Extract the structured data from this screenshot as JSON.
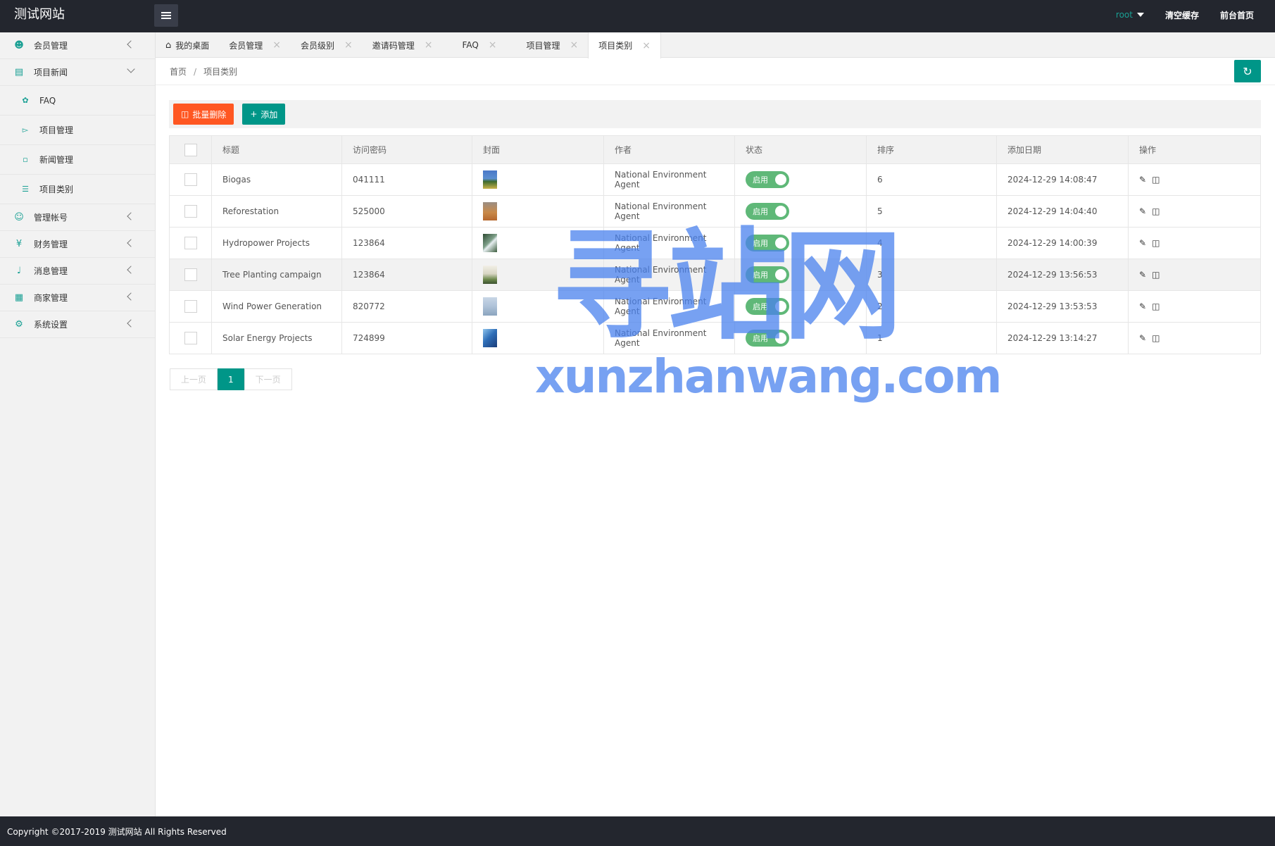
{
  "header": {
    "logo": "测试网站",
    "user": "root",
    "clear_cache": "清空缓存",
    "front_home": "前台首页"
  },
  "sidebar": {
    "items": [
      {
        "label": "会员管理",
        "icon": "user-icon"
      },
      {
        "label": "项目新闻",
        "icon": "book-icon"
      },
      {
        "label": "管理帐号",
        "icon": "users-icon"
      },
      {
        "label": "财务管理",
        "icon": "yen-icon"
      },
      {
        "label": "消息管理",
        "icon": "speaker-icon"
      },
      {
        "label": "商家管理",
        "icon": "picture-icon"
      },
      {
        "label": "系统设置",
        "icon": "gear-icon"
      }
    ],
    "sub_items": [
      {
        "label": "FAQ",
        "icon": "leaf-icon"
      },
      {
        "label": "项目管理",
        "icon": "cart-icon"
      },
      {
        "label": "新闻管理",
        "icon": "file-icon"
      },
      {
        "label": "项目类别",
        "icon": "list-icon"
      }
    ]
  },
  "tabs": [
    {
      "label": "我的桌面"
    },
    {
      "label": "会员管理"
    },
    {
      "label": "会员级别"
    },
    {
      "label": "邀请码管理"
    },
    {
      "label": "FAQ"
    },
    {
      "label": "项目管理"
    },
    {
      "label": "项目类别"
    }
  ],
  "breadcrumb": {
    "home": "首页",
    "separator": "/",
    "current": "项目类别"
  },
  "toolbar": {
    "batch_delete": "批量删除",
    "add": "添加"
  },
  "table": {
    "headers": [
      "标题",
      "访问密码",
      "封面",
      "作者",
      "状态",
      "排序",
      "添加日期",
      "操作"
    ],
    "rows": [
      {
        "title": "Biogas",
        "password": "041111",
        "author": "National Environment Agent",
        "status": "启用",
        "sort": "6",
        "date": "2024-12-29 14:08:47"
      },
      {
        "title": "Reforestation",
        "password": "525000",
        "author": "National Environment Agent",
        "status": "启用",
        "sort": "5",
        "date": "2024-12-29 14:04:40"
      },
      {
        "title": "Hydropower Projects",
        "password": "123864",
        "author": "National Environment Agent",
        "status": "启用",
        "sort": "4",
        "date": "2024-12-29 14:00:39"
      },
      {
        "title": "Tree Planting campaign",
        "password": "123864",
        "author": "National Environment Agent",
        "status": "启用",
        "sort": "3",
        "date": "2024-12-29 13:56:53"
      },
      {
        "title": "Wind Power Generation",
        "password": "820772",
        "author": "National Environment Agent",
        "status": "启用",
        "sort": "2",
        "date": "2024-12-29 13:53:53"
      },
      {
        "title": "Solar Energy Projects",
        "password": "724899",
        "author": "National Environment Agent",
        "status": "启用",
        "sort": "1",
        "date": "2024-12-29 13:14:27"
      }
    ]
  },
  "pager": {
    "prev": "上一页",
    "current": "1",
    "next": "下一页"
  },
  "watermark": {
    "cn": "寻站网",
    "en": "xunzhanwang.com"
  },
  "footer": {
    "copyright": "Copyright ©2017-2019 测试网站 All Rights Reserved"
  },
  "colors": {
    "accent": "#009688",
    "danger": "#ff5722",
    "switch_on": "#5fb878",
    "header_bg": "#23262e"
  }
}
